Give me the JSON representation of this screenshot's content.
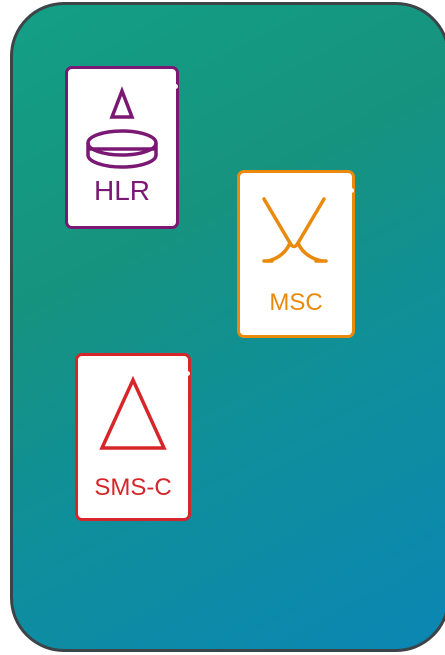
{
  "diagram": {
    "nodes": [
      {
        "id": "hlr",
        "label": "HLR",
        "icon": "hlr-database-icon",
        "color": "#7a1873"
      },
      {
        "id": "msc",
        "label": "MSC",
        "icon": "msc-switch-icon",
        "color": "#ea8a0d"
      },
      {
        "id": "smsc",
        "label": "SMS-C",
        "icon": "smsc-triangle-icon",
        "color": "#d7262a"
      }
    ],
    "colors": {
      "panel_border": "#3d4448",
      "gradient_start": "#139f86",
      "gradient_end": "#0b86b4"
    }
  }
}
